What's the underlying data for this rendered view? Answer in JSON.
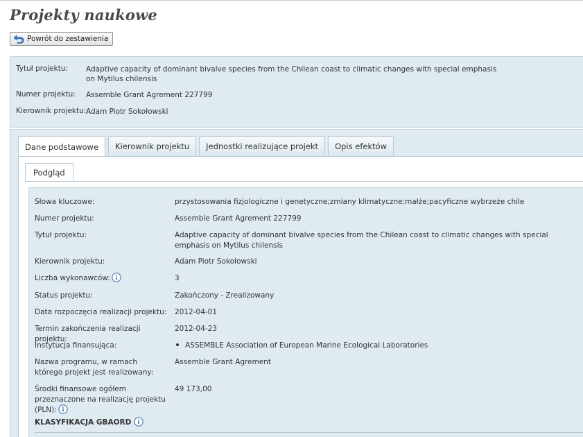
{
  "page": {
    "title": "Projekty naukowe"
  },
  "toolbar": {
    "back_label": "Powrót do zestawienia",
    "back_icon": "return-arrow-icon"
  },
  "summary": {
    "title_label": "Tytuł projektu:",
    "title_value": "Adaptive capacity of dominant bivalve species from the Chilean coast to climatic changes with special emphasis on Mytilus chilensis",
    "number_label": "Numer projektu:",
    "number_value": "Assemble Grant Agrement 227799",
    "manager_label": "Kierownik projektu:",
    "manager_value": "Adam Piotr Sokołowski"
  },
  "tabs": [
    {
      "label": "Dane podstawowe",
      "active": true
    },
    {
      "label": "Kierownik projektu",
      "active": false
    },
    {
      "label": "Jednostki realizujące projekt",
      "active": false
    },
    {
      "label": "Opis efektów",
      "active": false
    }
  ],
  "subtab": {
    "label": "Podgląd"
  },
  "details": {
    "keywords_label": "Słowa kluczowe:",
    "keywords_value": "przystosowania fizjologiczne i genetyczne;zmiany klimatyczne;małże;pacyficzne wybrzeże chile",
    "number_label": "Numer projektu:",
    "number_value": "Assemble Grant Agrement 227799",
    "title_label": "Tytuł projektu:",
    "title_value": "Adaptive capacity of dominant bivalve species from the Chilean coast to climatic changes with special emphasis on Mytilus chilensis",
    "manager_label": "Kierownik projektu:",
    "manager_value": "Adam Piotr Sokołowski",
    "contractors_label": "Liczba wykonawców:",
    "contractors_value": "3",
    "status_label": "Status projektu:",
    "status_value": "Zakończony - Zrealizowany",
    "start_label": "Data rozpoczęcia realizacji projektu:",
    "start_value": "2012-04-01",
    "end_label": "Termin zakończenia realizacji projektu:",
    "end_value": "2012-04-23",
    "institution_label": "Instytucja finansująca:",
    "institution_value": "ASSEMBLE Association of European Marine Ecological Laboratories",
    "program_label": "Nazwa programu, w ramach którego projekt jest realizowany:",
    "program_value": "Assemble Grant Agrement",
    "funds_label": "Środki finansowe ogółem przeznaczone na realizację projektu (PLN):",
    "funds_value": "49 173,00"
  },
  "classification": {
    "title": "KLASYFIKACJA GBAORD"
  },
  "colors": {
    "panel_bg": "#dfeaf1",
    "panel_border": "#c4d4df",
    "info_icon": "#3a6fb0"
  }
}
